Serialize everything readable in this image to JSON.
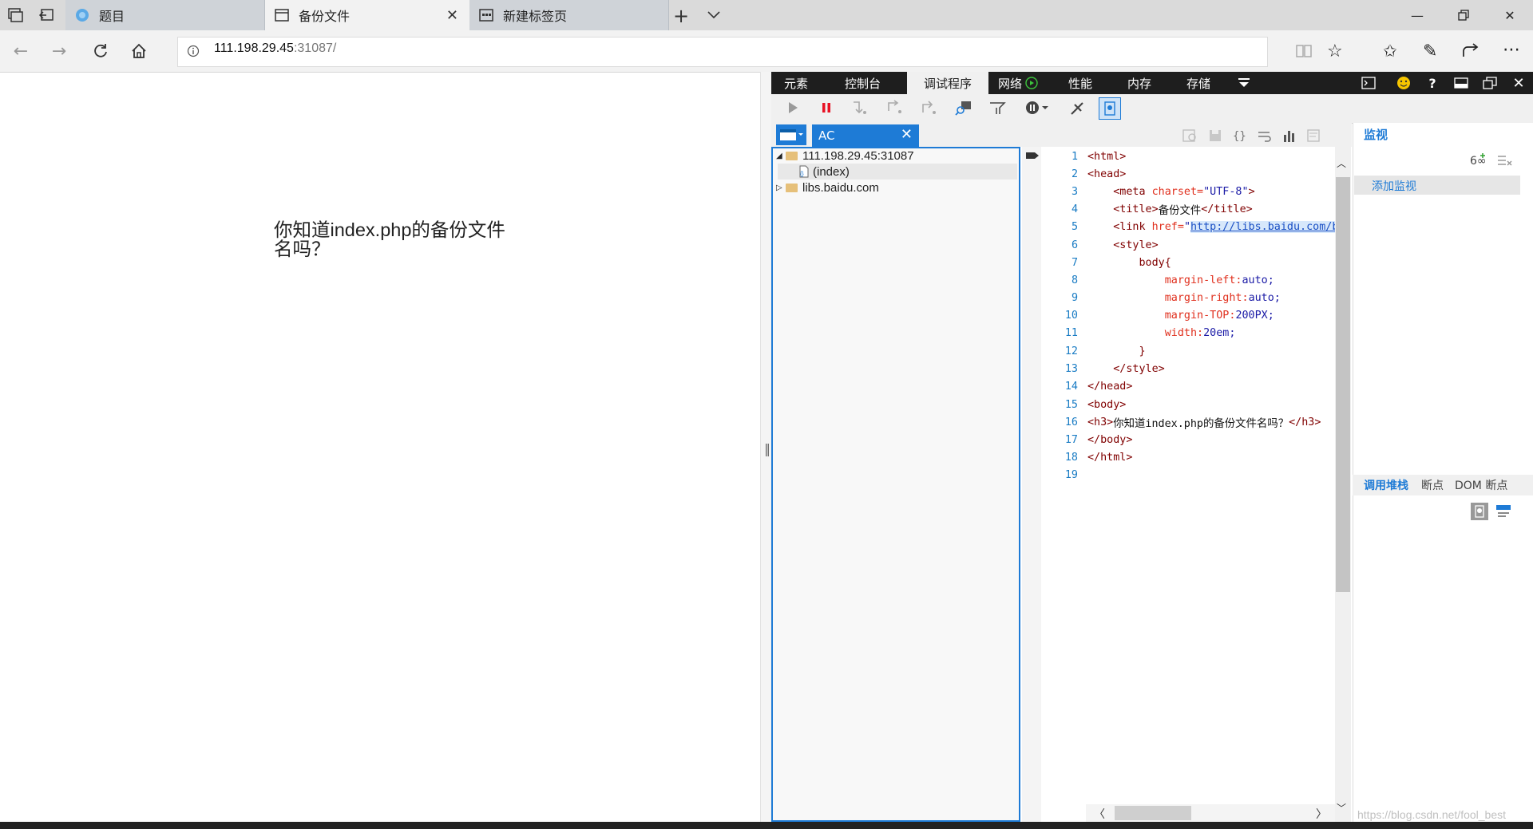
{
  "tabs": [
    {
      "label": "题目",
      "icon": "globe-icon"
    },
    {
      "label": "备份文件",
      "icon": "page-icon"
    },
    {
      "label": "新建标签页",
      "icon": "newtab-icon"
    }
  ],
  "address": {
    "host": "111.198.29.45",
    "rest": ":31087/"
  },
  "page": {
    "heading": "你知道index.php的备份文件名吗？"
  },
  "devtools": {
    "tabs": [
      "元素",
      "控制台",
      "调试程序",
      "网络",
      "性能",
      "内存",
      "存储"
    ],
    "active_tab": "调试程序",
    "file_tab": "AC",
    "tree": [
      {
        "label": "111.198.29.45:31087",
        "type": "folder-open"
      },
      {
        "label": "(index)",
        "type": "file"
      },
      {
        "label": "libs.baidu.com",
        "type": "folder-closed"
      }
    ],
    "code": [
      {
        "n": "1"
      },
      {
        "n": "2"
      },
      {
        "n": "3"
      },
      {
        "n": "4"
      },
      {
        "n": "5"
      },
      {
        "n": "6"
      },
      {
        "n": "7"
      },
      {
        "n": "8"
      },
      {
        "n": "9"
      },
      {
        "n": "10"
      },
      {
        "n": "11"
      },
      {
        "n": "12"
      },
      {
        "n": "13"
      },
      {
        "n": "14"
      },
      {
        "n": "15"
      },
      {
        "n": "16"
      },
      {
        "n": "17"
      },
      {
        "n": "18"
      },
      {
        "n": "19"
      }
    ],
    "code_text": {
      "l1": "<html>",
      "l2": "<head>",
      "l3a": "<meta ",
      "l3b": "charset=",
      "l3c": "\"UTF-8\"",
      "l3d": ">",
      "l4a": "<title>",
      "l4b": "备份文件",
      "l4c": "</title>",
      "l5a": "<link ",
      "l5b": "href=",
      "l5c": "\"",
      "l5d": "http://libs.baidu.com/boo",
      "l6": "<style>",
      "l7": "body{",
      "l8a": "margin-left:",
      "l8b": "auto;",
      "l9a": "margin-right:",
      "l9b": "auto;",
      "l10a": "margin-TOP:",
      "l10b": "200PX;",
      "l11a": "width:",
      "l11b": "20em;",
      "l12": "}",
      "l13": "</style>",
      "l14": "</head>",
      "l15": "<body>",
      "l16a": "<h3>",
      "l16b": "你知道index.php的备份文件名吗？",
      "l16c": "</h3>",
      "l17": "</body>",
      "l18": "</html>"
    },
    "watch": {
      "title": "监视",
      "add_label": "添加监视"
    },
    "bottom_tabs": [
      "调用堆栈",
      "断点",
      "DOM 断点"
    ]
  },
  "watermark": "https://blog.csdn.net/fool_best",
  "colors": {
    "accent": "#1e7bd6",
    "toolbar": "#1e1e1e",
    "tag": "#800000",
    "attr": "#e0301e"
  }
}
